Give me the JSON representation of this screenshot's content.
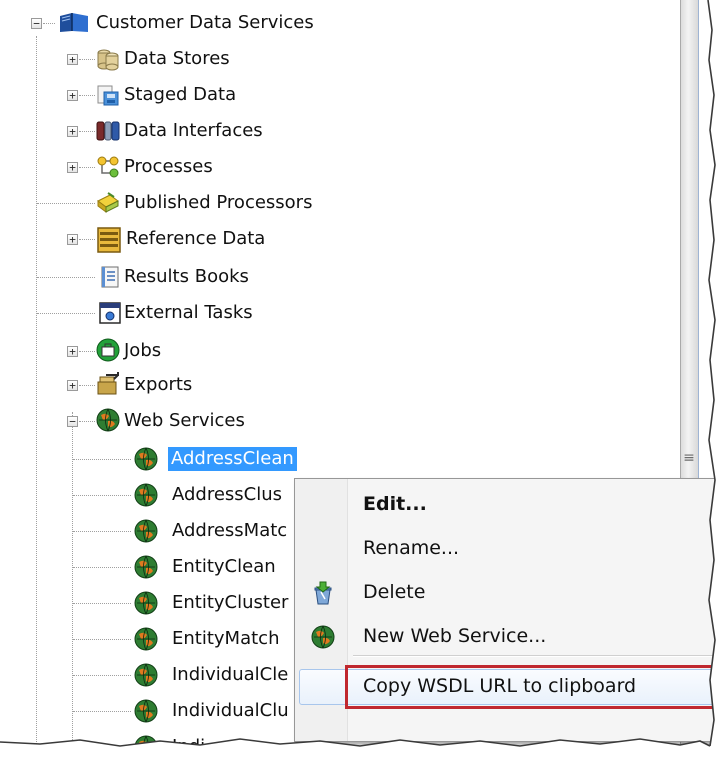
{
  "tree": {
    "root": {
      "label": "Customer Data Services",
      "icon": "book-icon",
      "expander": "−"
    },
    "children": [
      {
        "label": "Data Stores",
        "icon": "database-icon",
        "expander": "+"
      },
      {
        "label": "Staged Data",
        "icon": "staged-data-icon",
        "expander": "+"
      },
      {
        "label": "Data Interfaces",
        "icon": "data-interface-icon",
        "expander": "+"
      },
      {
        "label": "Processes",
        "icon": "process-icon",
        "expander": "+"
      },
      {
        "label": "Published Processors",
        "icon": "published-processor-icon",
        "expander": ""
      },
      {
        "label": "Reference Data",
        "icon": "reference-data-icon",
        "expander": "+"
      },
      {
        "label": "Results Books",
        "icon": "results-book-icon",
        "expander": ""
      },
      {
        "label": "External Tasks",
        "icon": "external-task-icon",
        "expander": ""
      },
      {
        "label": "Jobs",
        "icon": "job-icon",
        "expander": "+"
      },
      {
        "label": "Exports",
        "icon": "export-icon",
        "expander": "+"
      },
      {
        "label": "Web Services",
        "icon": "web-service-icon",
        "expander": "−"
      }
    ],
    "web_services": [
      {
        "label": "AddressClean",
        "selected": true
      },
      {
        "label": "AddressClus"
      },
      {
        "label": "AddressMatc"
      },
      {
        "label": "EntityClean"
      },
      {
        "label": "EntityCluster"
      },
      {
        "label": "EntityMatch"
      },
      {
        "label": "IndividualCle"
      },
      {
        "label": "IndividualClu"
      },
      {
        "label": "Indi"
      }
    ]
  },
  "scrollbar": {
    "grip": "≡"
  },
  "context_menu": {
    "items": [
      {
        "label": "Edit...",
        "bold": true,
        "icon": ""
      },
      {
        "label": "Rename...",
        "icon": ""
      },
      {
        "label": "Delete",
        "icon": "delete-icon"
      },
      {
        "label": "New Web Service...",
        "icon": "web-service-icon"
      },
      {
        "label": "Copy WSDL URL to clipboard",
        "icon": "",
        "highlighted": true
      }
    ]
  },
  "colors": {
    "selection": "#3399ff",
    "highlight_box": "#c0282f",
    "web_service_globe": "#2e7d32",
    "web_service_accent": "#e07a1f"
  }
}
